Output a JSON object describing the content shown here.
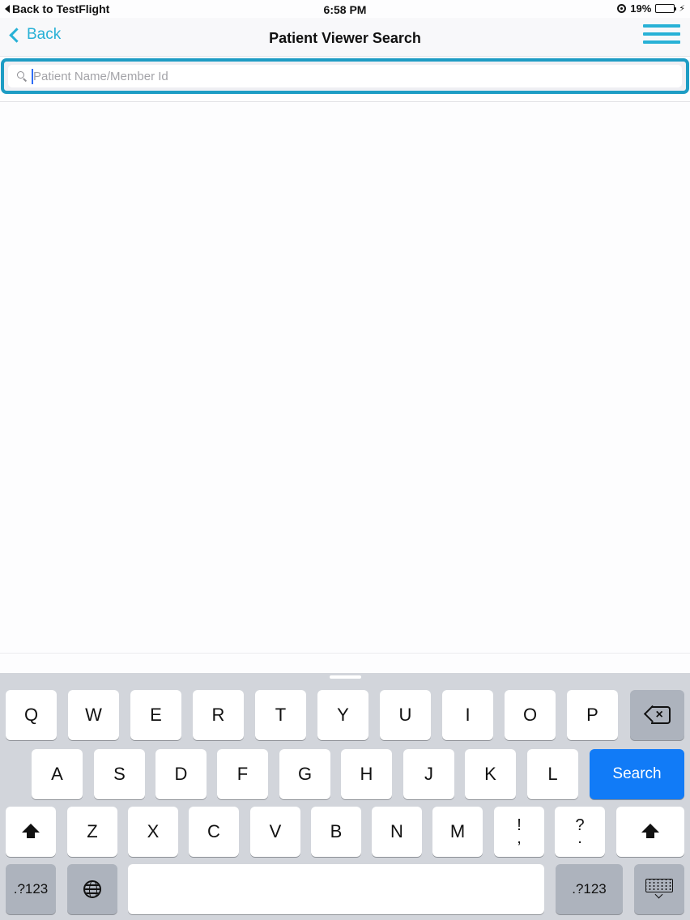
{
  "status_bar": {
    "back_label": "Back to TestFlight",
    "time": "6:58 PM",
    "battery_percent": "19%",
    "battery_level": 0.19,
    "battery_color": "#38c14a"
  },
  "nav": {
    "back_label": "Back",
    "title": "Patient Viewer Search",
    "accent_color": "#28b1d6"
  },
  "search": {
    "placeholder": "Patient Name/Member Id",
    "value": ""
  },
  "keyboard": {
    "row1": [
      "Q",
      "W",
      "E",
      "R",
      "T",
      "Y",
      "U",
      "I",
      "O",
      "P"
    ],
    "row2": [
      "A",
      "S",
      "D",
      "F",
      "G",
      "H",
      "J",
      "K",
      "L"
    ],
    "row3": [
      "Z",
      "X",
      "C",
      "V",
      "B",
      "N",
      "M"
    ],
    "punct1": {
      "top": "!",
      "bottom": ","
    },
    "punct2": {
      "top": "?",
      "bottom": "."
    },
    "search_label": "Search",
    "numbers_label": ".?123",
    "search_key_color": "#117bf7"
  }
}
